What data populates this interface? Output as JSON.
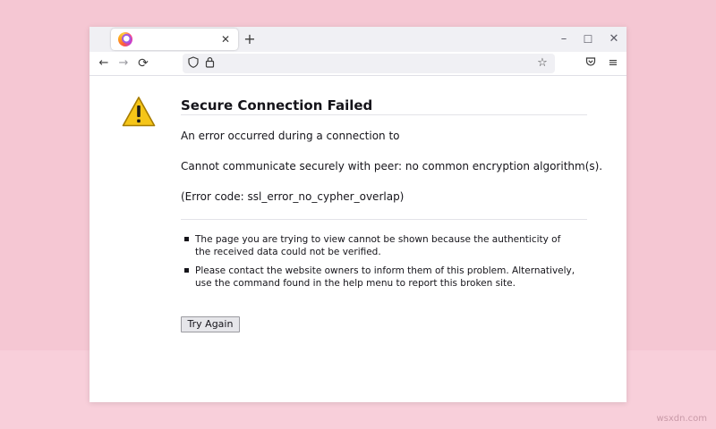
{
  "browser": {
    "tab": {
      "title": "",
      "close_glyph": "✕",
      "icon": "firefox-favicon"
    },
    "new_tab_glyph": "+",
    "window_controls": {
      "minimize": "–",
      "maximize": "☐",
      "close": "✕"
    },
    "nav": {
      "back": "←",
      "forward": "→",
      "reload": "⟳"
    },
    "url": {
      "shield": "⛉",
      "lock": "🔒",
      "bookmark": "☆"
    },
    "pocket": "♡",
    "menu": "≡"
  },
  "error_page": {
    "title": "Secure Connection Failed",
    "line1": "An error occurred during a connection to",
    "line2": "Cannot communicate securely with peer: no common encryption algorithm(s).",
    "line3": "(Error code: ssl_error_no_cypher_overlap)",
    "bullets": [
      "The page you are trying to view cannot be shown because the authenticity of the received data could not be verified.",
      "Please contact the website owners to inform them of this problem. Alternatively, use the command found in the help menu to report this broken site."
    ],
    "try_again_label": "Try Again",
    "warning_icon": "warning-triangle",
    "warning_color": "#f5c518"
  },
  "watermark": "wsxdn.com"
}
